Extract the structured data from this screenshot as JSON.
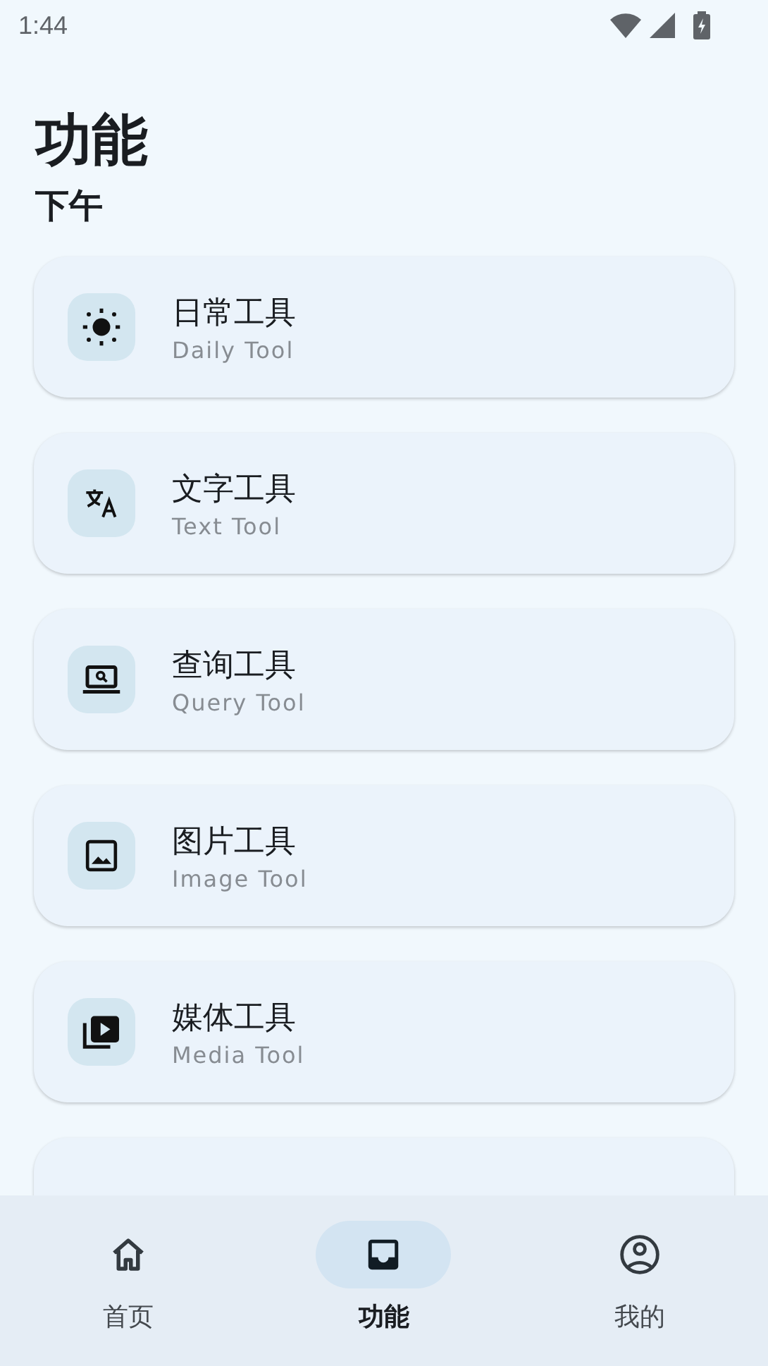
{
  "status_bar": {
    "time": "1:44"
  },
  "header": {
    "title": "功能",
    "subtitle": "下午"
  },
  "tools": [
    {
      "title": "日常工具",
      "subtitle": "Daily Tool"
    },
    {
      "title": "文字工具",
      "subtitle": "Text Tool"
    },
    {
      "title": "查询工具",
      "subtitle": "Query Tool"
    },
    {
      "title": "图片工具",
      "subtitle": "Image Tool"
    },
    {
      "title": "媒体工具",
      "subtitle": "Media Tool"
    }
  ],
  "nav": [
    {
      "label": "首页",
      "selected": false
    },
    {
      "label": "功能",
      "selected": true
    },
    {
      "label": "我的",
      "selected": false
    }
  ]
}
